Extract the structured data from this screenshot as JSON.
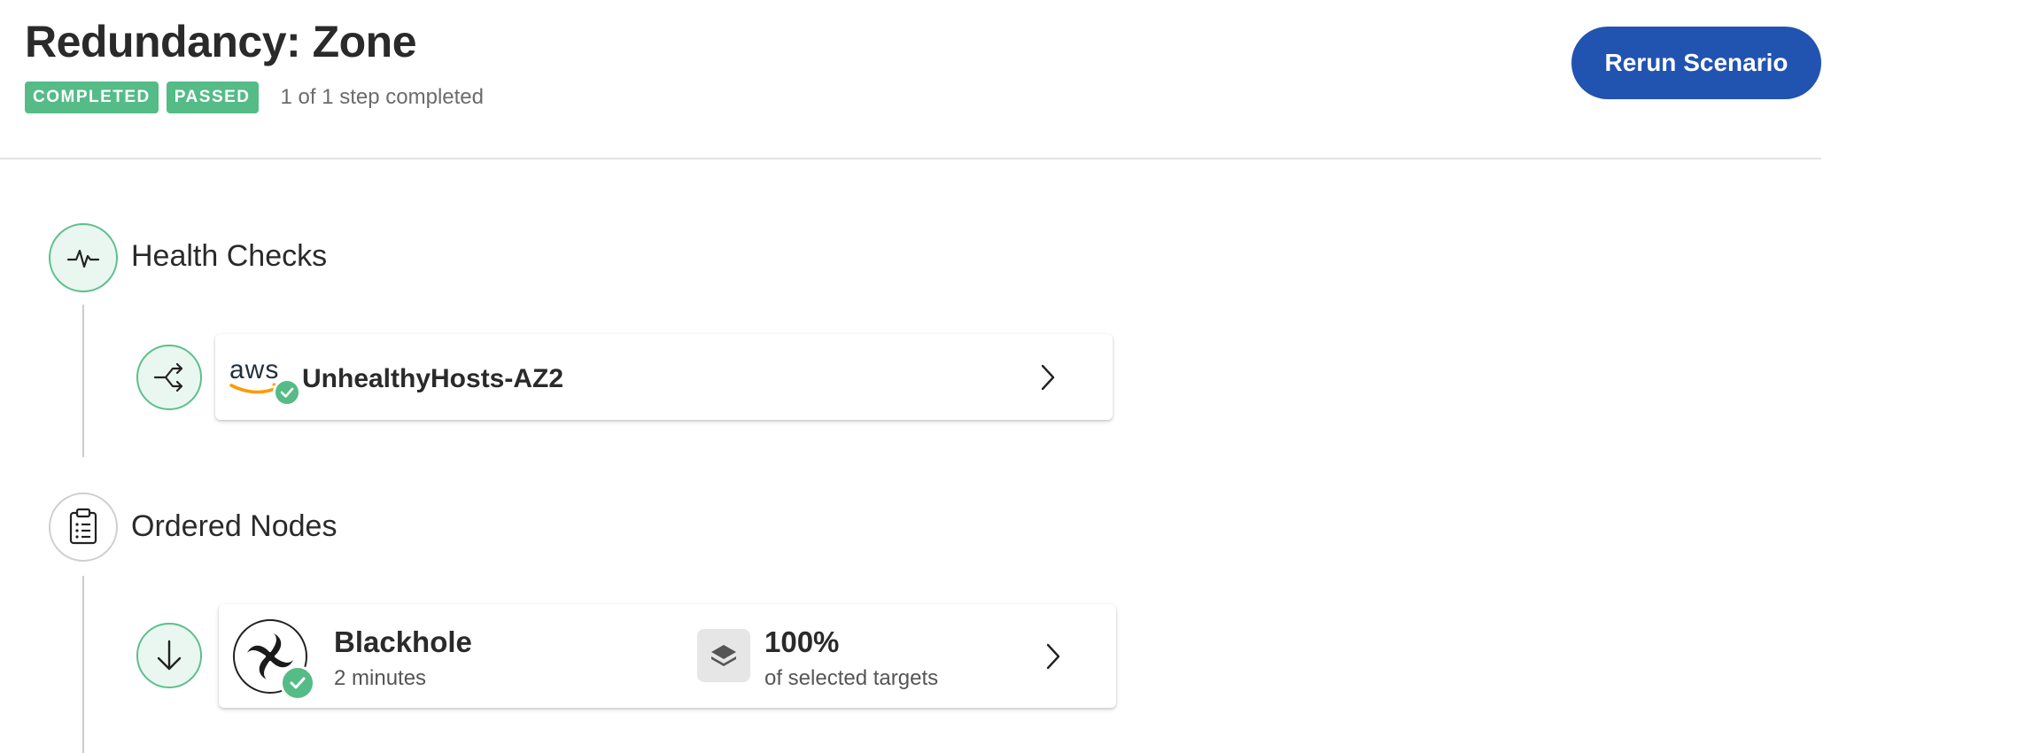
{
  "header": {
    "title": "Redundancy: Zone",
    "badges": [
      "COMPLETED",
      "PASSED"
    ],
    "steps_text": "1 of 1 step completed",
    "rerun_label": "Rerun Scenario"
  },
  "sections": [
    {
      "title": "Health Checks",
      "icon": "pulse-icon",
      "status": "completed",
      "items": [
        {
          "step_icon": "split-arrow-icon",
          "provider_icon": "aws-logo",
          "provider_text": "aws",
          "name": "UnhealthyHosts-AZ2",
          "status_icon": "check-icon"
        }
      ]
    },
    {
      "title": "Ordered Nodes",
      "icon": "clipboard-list-icon",
      "items": [
        {
          "step_icon": "arrow-down-icon",
          "attack_icon": "blackhole-icon",
          "name": "Blackhole",
          "duration": "2 minutes",
          "targets_icon": "layers-icon",
          "target_percent": "100%",
          "target_label": "of selected targets",
          "status_icon": "check-icon"
        }
      ]
    }
  ],
  "colors": {
    "accent": "#2153b0",
    "success": "#55bb87",
    "success_bg": "#eaf7f0",
    "aws_orange": "#ff9900"
  }
}
